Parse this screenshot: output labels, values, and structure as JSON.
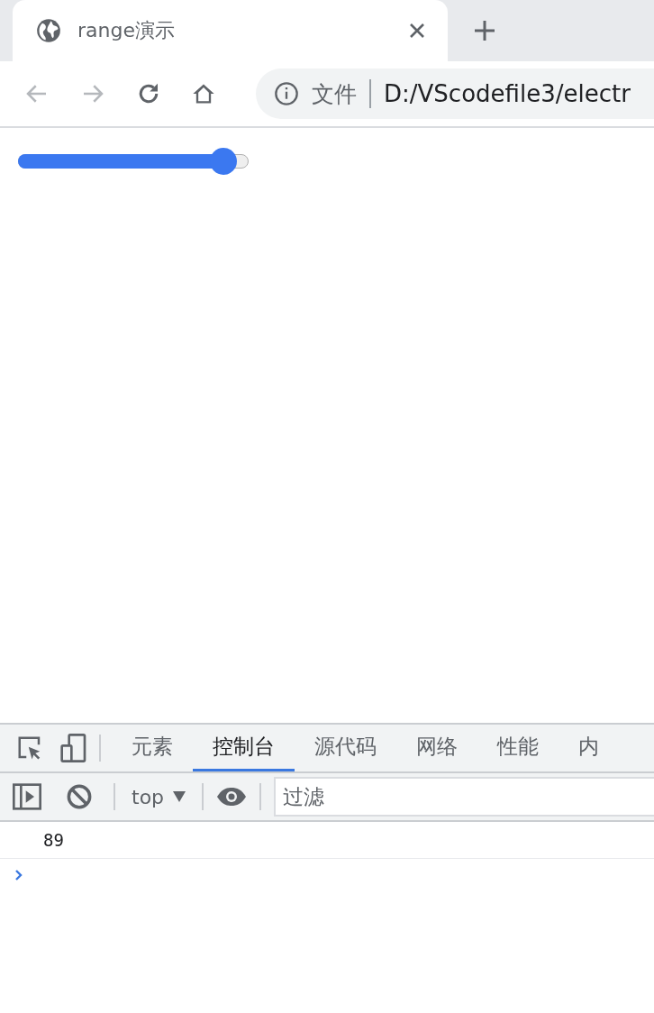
{
  "browser_tab": {
    "title": "range演示"
  },
  "address_bar": {
    "scheme_label": "文件",
    "url": "D:/VScodefile3/electr"
  },
  "page": {
    "slider": {
      "level": 0.89
    }
  },
  "devtools": {
    "tabs": [
      {
        "label": "元素",
        "selected": false
      },
      {
        "label": "控制台",
        "selected": true
      },
      {
        "label": "源代码",
        "selected": false
      },
      {
        "label": "网络",
        "selected": false
      },
      {
        "label": "性能",
        "selected": false
      },
      {
        "label": "内",
        "selected": false
      }
    ],
    "context": "top",
    "filter": {
      "placeholder": "过滤"
    },
    "console_lines": [
      "89"
    ]
  }
}
